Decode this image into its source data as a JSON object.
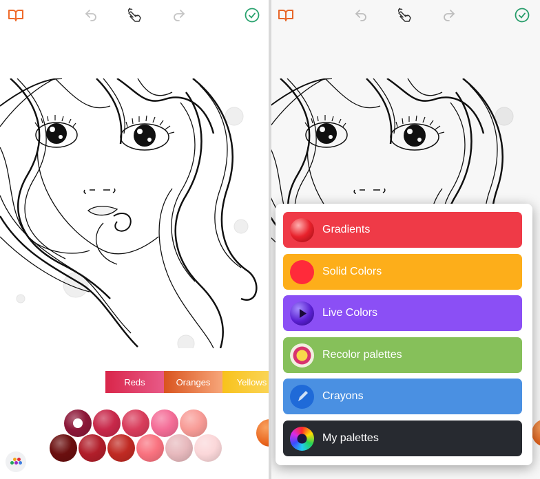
{
  "toolbar": {
    "items": [
      {
        "name": "library",
        "icon": "book-icon",
        "color": "#ef6a2a"
      },
      {
        "name": "undo",
        "icon": "undo-icon",
        "color": "#c4c4c4"
      },
      {
        "name": "tap-mode",
        "icon": "hand-pointer-icon",
        "color": "#333333"
      },
      {
        "name": "redo",
        "icon": "redo-icon",
        "color": "#c4c4c4"
      },
      {
        "name": "done",
        "icon": "check-circle-icon",
        "color": "#2aa36f"
      }
    ]
  },
  "left_screen": {
    "categories": [
      {
        "label": "Reds",
        "color_from": "#d9264a",
        "color_to": "#e85a88"
      },
      {
        "label": "Oranges",
        "color_from": "#d9541e",
        "color_to": "#f7a67a"
      },
      {
        "label": "Yellows",
        "color_from": "#f8c21c",
        "color_to": "#fbd964"
      }
    ],
    "swatches": {
      "row1": [
        "#8c1738",
        "#c8284a",
        "#d93d5c",
        "#f46d97",
        "#f89c97"
      ],
      "row2": [
        "#6b0f0f",
        "#b11e2a",
        "#c02a23",
        "#f9727f",
        "#e7b9bd",
        "#fbd7d9"
      ],
      "selected_index": 0
    },
    "next_color": "#ec6d25",
    "palette_button": {
      "icon": "palette-dots-icon",
      "dots": [
        "#f2a51a",
        "#e02a3a",
        "#1fa55a",
        "#9a2cc4",
        "#3c7de0"
      ]
    }
  },
  "right_screen": {
    "menu": [
      {
        "label": "Gradients",
        "color": "#ef3a47",
        "icon": "gradient-sphere-icon"
      },
      {
        "label": "Solid Colors",
        "color": "#fdae1a",
        "icon": "solid-circle-icon"
      },
      {
        "label": "Live Colors",
        "color": "#8b4ff5",
        "icon": "play-sphere-icon"
      },
      {
        "label": "Recolor palettes",
        "color": "#86c05a",
        "icon": "recolor-target-icon"
      },
      {
        "label": "Crayons",
        "color": "#4a90e2",
        "icon": "crayon-icon"
      },
      {
        "label": "My palettes",
        "color": "#272a30",
        "icon": "color-wheel-icon"
      }
    ]
  }
}
